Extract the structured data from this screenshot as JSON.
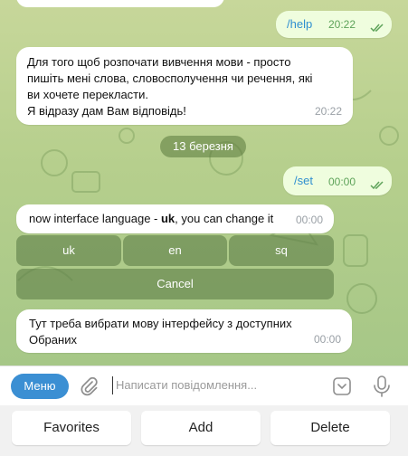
{
  "messages": {
    "help_cmd": {
      "text": "/help",
      "time": "20:22"
    },
    "intro": {
      "line1": "Для того щоб розпочати вивчення мови - просто",
      "line2": "пишіть мені слова, словосполучення чи речення, які",
      "line3": "ви хочете перекласти.",
      "line4": "Я відразу дам Вам відповідь!",
      "time": "20:22"
    },
    "date_separator": "13 березня",
    "set_cmd": {
      "text": "/set",
      "time": "00:00"
    },
    "lang_msg": {
      "prefix": "now interface language - ",
      "lang": "uk",
      "suffix": ", you can change it",
      "time": "00:00"
    },
    "inline_keyboard": {
      "uk": "uk",
      "en": "en",
      "sq": "sq",
      "cancel": "Cancel"
    },
    "last": {
      "line1": "Тут треба вибрати мову інтерфейсу з доступних",
      "line2": "Обраних",
      "time": "00:00"
    }
  },
  "composer": {
    "menu_label": "Меню",
    "placeholder": "Написати повідомлення..."
  },
  "reply_keyboard": {
    "favorites": "Favorites",
    "add": "Add",
    "delete": "Delete"
  },
  "icons": {
    "attach": "paperclip-icon",
    "sticker": "sticker-icon",
    "mic": "microphone-icon",
    "read": "double-check-icon"
  },
  "colors": {
    "accent": "#3b8fd3",
    "chat_bg": "#b6cf8d",
    "outgoing": "#effdde"
  }
}
